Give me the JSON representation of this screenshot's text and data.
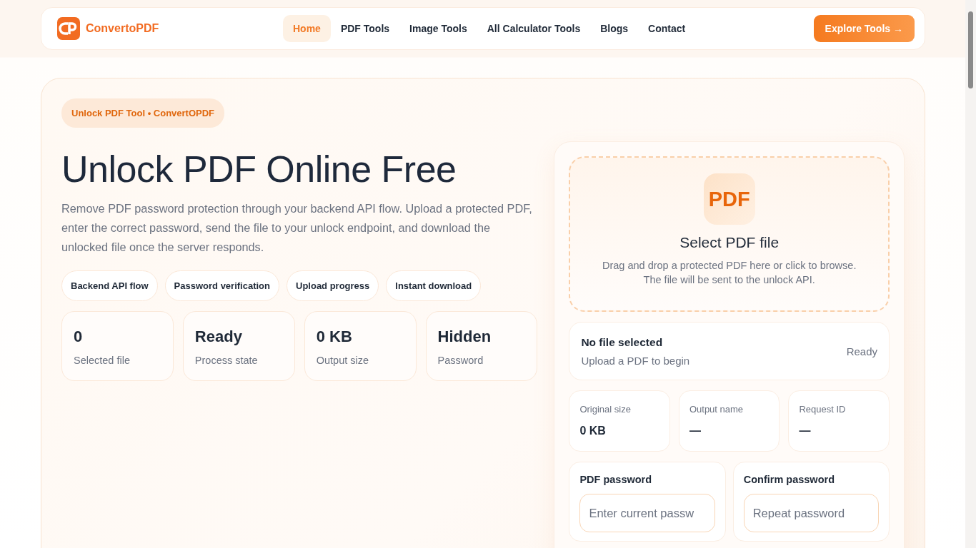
{
  "header": {
    "logo_text": "ConvertoPDF",
    "nav": [
      {
        "label": "Home",
        "selected": true
      },
      {
        "label": "PDF Tools",
        "selected": false
      },
      {
        "label": "Image Tools",
        "selected": false
      },
      {
        "label": "All Calculator Tools",
        "selected": false
      },
      {
        "label": "Blogs",
        "selected": false
      },
      {
        "label": "Contact",
        "selected": false
      }
    ],
    "cta": "Explore Tools →"
  },
  "hero": {
    "badge": "Unlock PDF Tool • ConvertOPDF",
    "title": "Unlock PDF Online Free",
    "description": "Remove PDF password protection through your backend API flow. Upload a protected PDF, enter the correct password, send the file to your unlock endpoint, and download the unlocked file once the server responds.",
    "features": [
      "Backend API flow",
      "Password verification",
      "Upload progress",
      "Instant download"
    ],
    "stats": [
      {
        "value": "0",
        "label": "Selected file"
      },
      {
        "value": "Ready",
        "label": "Process state"
      },
      {
        "value": "0 KB",
        "label": "Output size"
      },
      {
        "value": "Hidden",
        "label": "Password"
      }
    ]
  },
  "upload": {
    "icon_text": "PDF",
    "title": "Select PDF file",
    "hint_lines": [
      "Drag and drop a protected PDF here or click to browse.",
      "The file will be sent to the unlock API."
    ]
  },
  "file_status": {
    "title": "No file selected",
    "subtitle": "Upload a PDF to begin",
    "state": "Ready"
  },
  "details": [
    {
      "label": "Original size",
      "value": "0 KB"
    },
    {
      "label": "Output name",
      "value": "—"
    },
    {
      "label": "Request ID",
      "value": "—"
    }
  ],
  "passwords": [
    {
      "label": "PDF password",
      "placeholder": "Enter current passw"
    },
    {
      "label": "Confirm password",
      "placeholder": "Repeat password"
    }
  ]
}
